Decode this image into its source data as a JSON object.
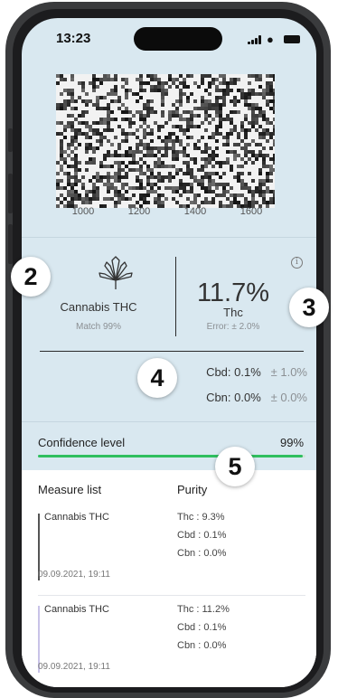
{
  "status_bar": {
    "time": "13:23"
  },
  "spectrum": {
    "x_ticks": [
      "1000",
      "1200",
      "1400",
      "1600"
    ]
  },
  "result": {
    "substance": "Cannabis THC",
    "match": "Match 99%",
    "main_percent": "11.7%",
    "main_compound": "Thc",
    "error": "Error: ± 2.0%",
    "others": [
      {
        "label": "Cbd: 0.1%",
        "tolerance": "± 1.0%"
      },
      {
        "label": "Cbn: 0.0%",
        "tolerance": "± 0.0%"
      }
    ]
  },
  "confidence": {
    "label": "Confidence level",
    "value": "99%",
    "fraction": 0.99,
    "color": "#2fbf5f"
  },
  "measure_list": {
    "header_left": "Measure list",
    "header_right": "Purity",
    "items": [
      {
        "name": "Cannabis THC",
        "thc": "Thc : 9.3%",
        "cbd": "Cbd : 0.1%",
        "cbn": "Cbn : 0.0%",
        "date": "09.09.2021, 19:11"
      },
      {
        "name": "Cannabis THC",
        "thc": "Thc : 11.2%",
        "cbd": "Cbd : 0.1%",
        "cbn": "Cbn : 0.0%",
        "date": "09.09.2021, 19:11"
      }
    ]
  },
  "callouts": [
    "2",
    "3",
    "4",
    "5"
  ],
  "colors": {
    "background": "#d9e8f0",
    "accent_green": "#2fbf5f",
    "frame": "#1c1c1e"
  }
}
